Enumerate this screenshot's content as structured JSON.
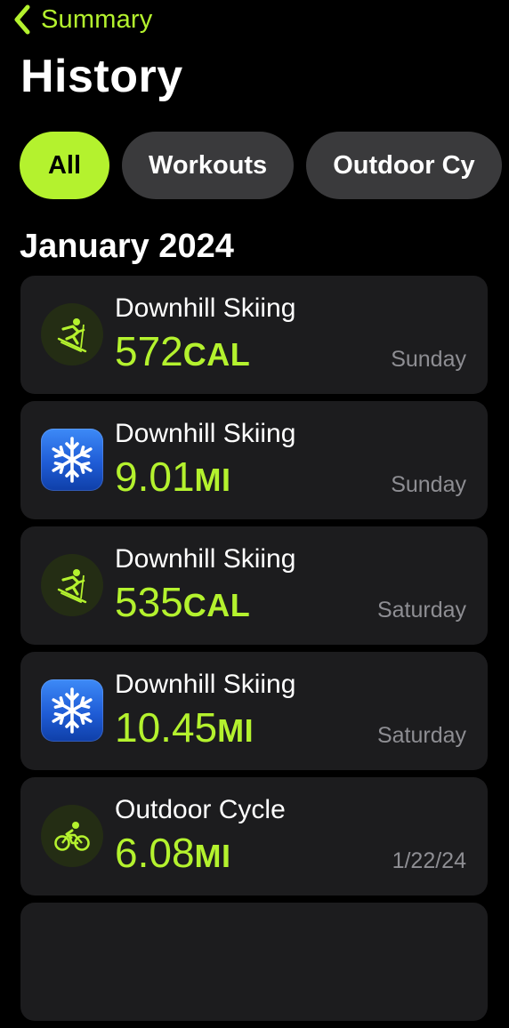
{
  "nav": {
    "back_label": "Summary",
    "back_icon": "chevron-left-icon",
    "accent_color": "#b4f22e"
  },
  "page": {
    "title": "History"
  },
  "filters": [
    {
      "label": "All",
      "active": true
    },
    {
      "label": "Workouts",
      "active": false
    },
    {
      "label": "Outdoor Cy",
      "active": false
    }
  ],
  "section": {
    "title": "January 2024"
  },
  "workouts": [
    {
      "name": "Downhill Skiing",
      "value": "572",
      "unit": "CAL",
      "day": "Sunday",
      "icon": "skier-icon"
    },
    {
      "name": "Downhill Skiing",
      "value": "9.01",
      "unit": "MI",
      "day": "Sunday",
      "icon": "snowflake-app-icon"
    },
    {
      "name": "Downhill Skiing",
      "value": "535",
      "unit": "CAL",
      "day": "Saturday",
      "icon": "skier-icon"
    },
    {
      "name": "Downhill Skiing",
      "value": "10.45",
      "unit": "MI",
      "day": "Saturday",
      "icon": "snowflake-app-icon"
    },
    {
      "name": "Outdoor Cycle",
      "value": "6.08",
      "unit": "MI",
      "day": "1/22/24",
      "icon": "cyclist-icon"
    }
  ]
}
